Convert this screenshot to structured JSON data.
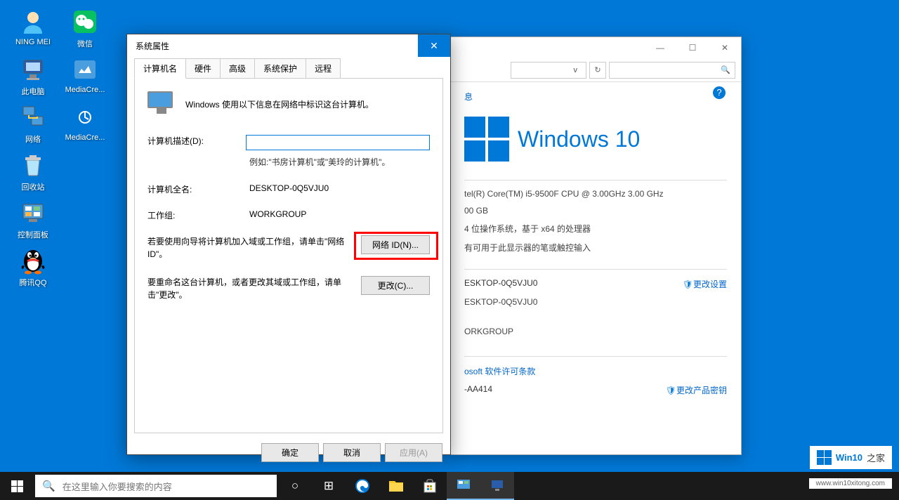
{
  "desktop": {
    "icons": [
      {
        "label": "NING MEI"
      },
      {
        "label": "微信"
      },
      {
        "label": "此电脑"
      },
      {
        "label": "MediaCre..."
      },
      {
        "label": "网络"
      },
      {
        "label": "MediaCre..."
      },
      {
        "label": "回收站"
      },
      {
        "label": ""
      },
      {
        "label": "控制面板"
      },
      {
        "label": ""
      },
      {
        "label": "腾讯QQ"
      },
      {
        "label": ""
      }
    ]
  },
  "props_dialog": {
    "title": "系统属性",
    "tabs": [
      "计算机名",
      "硬件",
      "高级",
      "系统保护",
      "远程"
    ],
    "description": "Windows 使用以下信息在网络中标识这台计算机。",
    "desc_label": "计算机描述(D):",
    "desc_value": "",
    "example": "例如:\"书房计算机\"或\"美玲的计算机\"。",
    "fullname_label": "计算机全名:",
    "fullname_value": "DESKTOP-0Q5VJU0",
    "workgroup_label": "工作组:",
    "workgroup_value": "WORKGROUP",
    "wizard_text": "若要使用向导将计算机加入域或工作组，请单击\"网络 ID\"。",
    "network_id_btn": "网络 ID(N)...",
    "rename_text": "要重命名这台计算机，或者更改其域或工作组，请单击\"更改\"。",
    "change_btn": "更改(C)...",
    "ok_btn": "确定",
    "cancel_btn": "取消",
    "apply_btn": "应用(A)"
  },
  "system_window": {
    "link1": "息",
    "logo_text": "Windows 10",
    "cpu": "tel(R) Core(TM) i5-9500F CPU @ 3.00GHz   3.00 GHz",
    "ram": "00 GB",
    "system_type": "4 位操作系统，基于 x64 的处理器",
    "pen": "有可用于此显示器的笔或触控输入",
    "computer_name": "ESKTOP-0Q5VJU0",
    "change_settings": "更改设置",
    "full_name": "ESKTOP-0Q5VJU0",
    "workgroup": "ORKGROUP",
    "license_link": "osoft 软件许可条款",
    "product_id": "-AA414",
    "change_key": "更改产品密钥",
    "dropdown": "v"
  },
  "taskbar": {
    "search_placeholder": "在这里输入你要搜索的内容"
  },
  "watermark": {
    "main": "Win10",
    "suffix": "之家",
    "url": "www.win10xitong.com"
  }
}
